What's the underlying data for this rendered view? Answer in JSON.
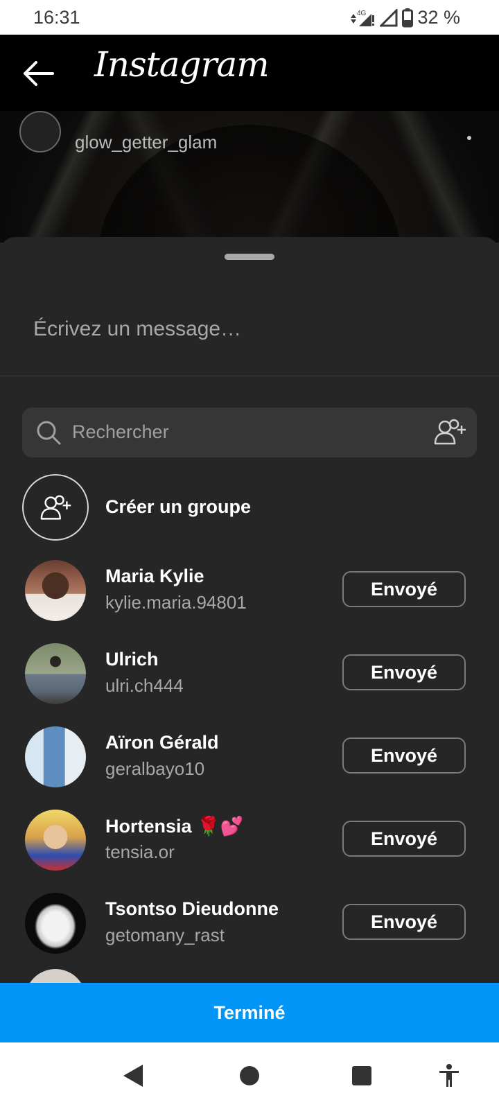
{
  "status_bar": {
    "time": "16:31",
    "network": "4G",
    "battery": "32 %"
  },
  "header": {
    "app_title": "Instagram"
  },
  "background_post": {
    "username": "glow_getter_glam"
  },
  "sheet": {
    "message_placeholder": "Écrivez un message…",
    "search_placeholder": "Rechercher",
    "create_group_label": "Créer un groupe",
    "contacts": [
      {
        "name": "Maria Kylie",
        "username": "kylie.maria.94801",
        "button": "Envoyé"
      },
      {
        "name": "Ulrich",
        "username": "ulri.ch444",
        "button": "Envoyé"
      },
      {
        "name": "Aïron Gérald",
        "username": "geralbayo10",
        "button": "Envoyé"
      },
      {
        "name": "Hortensia 🌹💕",
        "username": "tensia.or",
        "button": "Envoyé"
      },
      {
        "name": "Tsontso Dieudonne",
        "username": "getomany_rast",
        "button": "Envoyé"
      }
    ],
    "done_label": "Terminé"
  },
  "colors": {
    "accent": "#0095f6",
    "sheet_bg": "#262626",
    "secondary_text": "#a8a8a8"
  },
  "icons": [
    "back-arrow-icon",
    "search-icon",
    "add-people-icon",
    "create-group-icon",
    "nav-back-icon",
    "nav-home-icon",
    "nav-recents-icon",
    "accessibility-icon"
  ]
}
